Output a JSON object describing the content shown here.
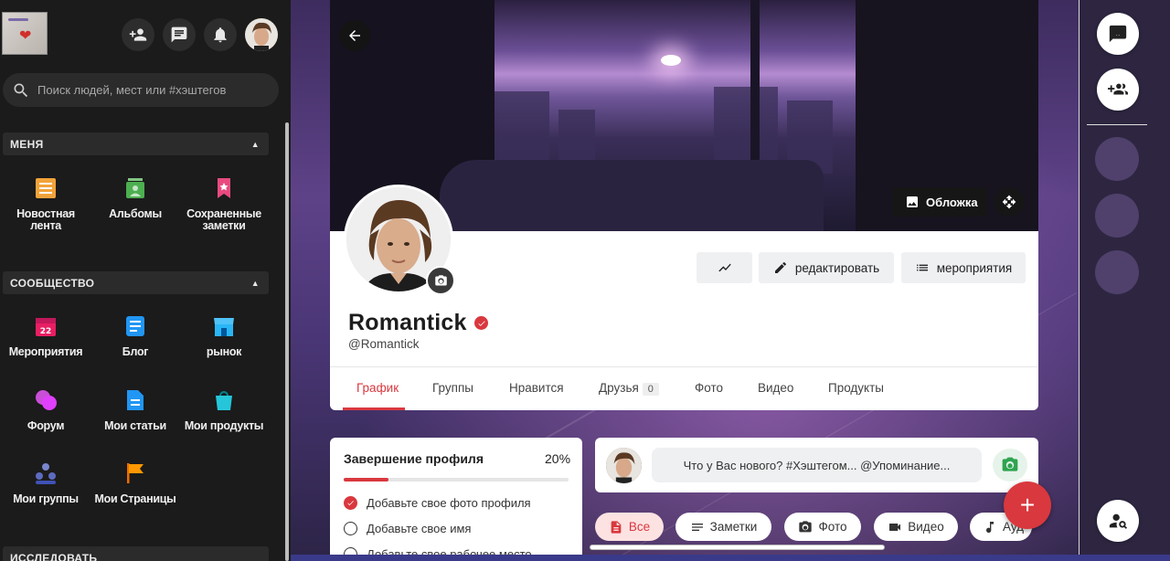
{
  "topbar": {
    "icons": [
      "add-user-icon",
      "message-icon",
      "bell-icon"
    ]
  },
  "search": {
    "placeholder": "Поиск людей, мест или #хэштегов"
  },
  "sidebar": {
    "sections": [
      {
        "title": "МЕНЯ",
        "items": [
          {
            "label": "Новостная лента",
            "icon": "news-feed-icon",
            "color": "#f2a33a"
          },
          {
            "label": "Альбомы",
            "icon": "albums-icon",
            "color": "#4caf50"
          },
          {
            "label": "Сохраненные заметки",
            "icon": "bookmark-icon",
            "color": "#e84a7f"
          }
        ]
      },
      {
        "title": "СООБЩЕСТВО",
        "items": [
          {
            "label": "Мероприятия",
            "icon": "calendar-icon",
            "color": "#e91e63"
          },
          {
            "label": "Блог",
            "icon": "blog-icon",
            "color": "#2196f3"
          },
          {
            "label": "рынок",
            "icon": "store-icon",
            "color": "#29b6f6"
          },
          {
            "label": "Форум",
            "icon": "forum-icon",
            "color": "#c94fd8"
          },
          {
            "label": "Мои статьи",
            "icon": "articles-icon",
            "color": "#2196f3"
          },
          {
            "label": "Мои продукты",
            "icon": "shopping-bag-icon",
            "color": "#26c6da"
          },
          {
            "label": "Мои группы",
            "icon": "groups-icon",
            "color": "#5c6bc0"
          },
          {
            "label": "Мои Страницы",
            "icon": "flag-icon",
            "color": "#ff9800"
          }
        ]
      }
    ],
    "cut_section": "ИССЛЕДОВАТЬ"
  },
  "cover": {
    "cover_label": "Обложка"
  },
  "profile": {
    "name": "Romantick",
    "handle": "@Romantick",
    "actions": {
      "activity_icon": "activity-icon",
      "edit": "редактировать",
      "events": "мероприятия"
    },
    "tabs": [
      {
        "label": "График",
        "active": true
      },
      {
        "label": "Группы"
      },
      {
        "label": "Нравится"
      },
      {
        "label": "Друзья",
        "count": "0"
      },
      {
        "label": "Фото"
      },
      {
        "label": "Видео"
      },
      {
        "label": "Продукты"
      }
    ]
  },
  "completion": {
    "title": "Завершение профиля",
    "percent": "20%",
    "progress_fraction": 0.2,
    "items": [
      {
        "label": "Добавьте свое фото профиля",
        "done": true
      },
      {
        "label": "Добавьте свое имя",
        "done": false
      },
      {
        "label": "Добавьте свое рабочее место",
        "done": false
      }
    ]
  },
  "composer": {
    "placeholder": "Что у Вас нового? #Хэштегом... @Упоминание..."
  },
  "filters": [
    {
      "label": "Все",
      "active": true
    },
    {
      "label": "Заметки"
    },
    {
      "label": "Фото"
    },
    {
      "label": "Видео"
    },
    {
      "label": "Ауд"
    }
  ],
  "colors": {
    "accent": "#d9383e",
    "sidebar_bg": "#1b1b1b"
  }
}
